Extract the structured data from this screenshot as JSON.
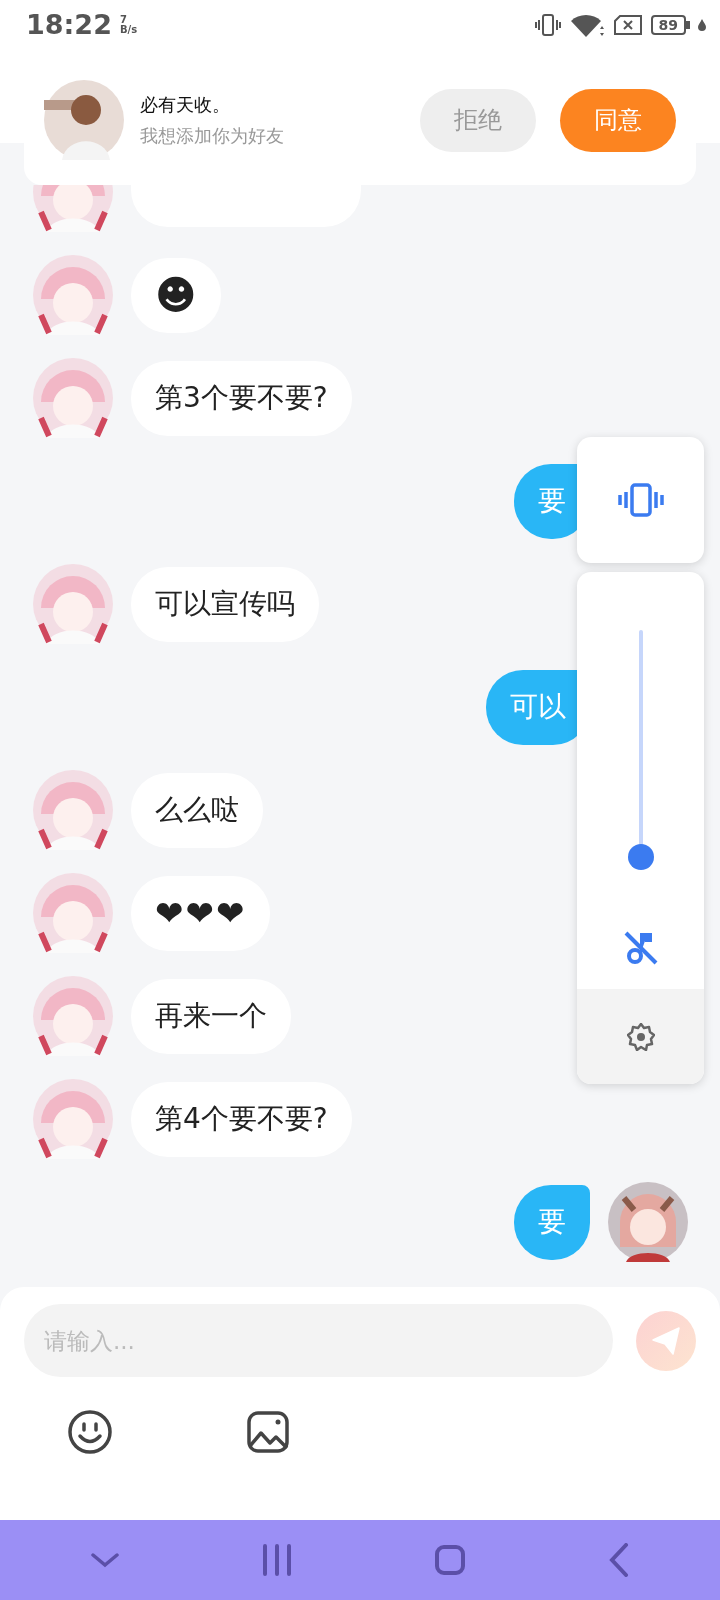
{
  "status_bar": {
    "time": "18:22",
    "speed_value": "7",
    "speed_unit": "B/s",
    "battery": "89"
  },
  "friend_request": {
    "name": "必有天收。",
    "message": "我想添加你为好友",
    "buttons": [
      {
        "label": "拒绝",
        "kind": "secondary"
      },
      {
        "label": "同意",
        "kind": "primary"
      }
    ]
  },
  "messages": [
    {
      "outgoing": false,
      "kind": "covered"
    },
    {
      "outgoing": false,
      "text": "☻",
      "kind": "emoji"
    },
    {
      "outgoing": false,
      "text": "第3个要不要?",
      "kind": "text"
    },
    {
      "outgoing": true,
      "text": "要",
      "kind": "text",
      "avatar_shown": false
    },
    {
      "outgoing": false,
      "text": "可以宣传吗",
      "kind": "text"
    },
    {
      "outgoing": true,
      "text": "可以",
      "kind": "text",
      "avatar_shown": false
    },
    {
      "outgoing": false,
      "text": "么么哒",
      "kind": "text"
    },
    {
      "outgoing": false,
      "text": "❤❤❤",
      "kind": "hearts"
    },
    {
      "outgoing": false,
      "text": "再来一个",
      "kind": "text"
    },
    {
      "outgoing": false,
      "text": "第4个要不要?",
      "kind": "text"
    },
    {
      "outgoing": true,
      "text": "要",
      "kind": "text",
      "avatar_shown": true
    }
  ],
  "volume_panel": {
    "level": 0
  },
  "composer": {
    "placeholder": "请输入...",
    "send_disabled": true
  }
}
